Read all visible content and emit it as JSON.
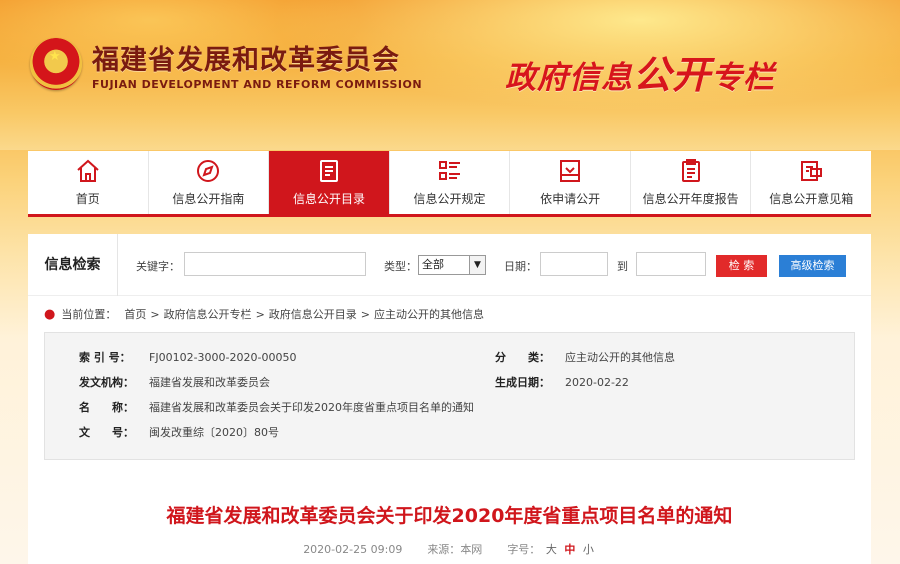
{
  "header": {
    "org_cn": "福建省发展和改革委员会",
    "org_en": "FUJIAN DEVELOPMENT AND REFORM COMMISSION",
    "column_title_a": "政府信息",
    "column_title_b": "公开",
    "column_title_c": "专栏"
  },
  "nav": {
    "items": [
      {
        "label": "首页",
        "icon": "home-icon"
      },
      {
        "label": "信息公开指南",
        "icon": "compass-icon"
      },
      {
        "label": "信息公开目录",
        "icon": "document-list-icon"
      },
      {
        "label": "信息公开规定",
        "icon": "rules-list-icon"
      },
      {
        "label": "依申请公开",
        "icon": "inbox-icon"
      },
      {
        "label": "信息公开年度报告",
        "icon": "clipboard-icon"
      },
      {
        "label": "信息公开意见箱",
        "icon": "feedback-icon"
      }
    ],
    "active_index": 2,
    "active_color": "#d0161c"
  },
  "search": {
    "title": "信息检索",
    "keyword_label": "关键字：",
    "keyword_value": "",
    "type_label": "类型：",
    "type_selected": "全部",
    "date_label": "日期：",
    "date_to_label": "到",
    "search_button": "检 索",
    "advanced_button": "高级检索"
  },
  "breadcrumb": {
    "prefix": "当前位置：",
    "items": [
      "首页",
      "政府信息公开专栏",
      "政府信息公开目录",
      "应主动公开的其他信息"
    ],
    "separator": ">"
  },
  "info": {
    "index_key": "索 引 号：",
    "index_value": "FJ00102-3000-2020-00050",
    "category_key": "分　　类：",
    "category_value": "应主动公开的其他信息",
    "issuer_key": "发文机构：",
    "issuer_value": "福建省发展和改革委员会",
    "date_key": "生成日期：",
    "date_value": "2020-02-22",
    "name_key": "名　　称：",
    "name_value": "福建省发展和改革委员会关于印发2020年度省重点项目名单的通知",
    "docno_key": "文　　号：",
    "docno_value": "闽发改重综〔2020〕80号"
  },
  "document": {
    "title": "福建省发展和改革委员会关于印发2020年度省重点项目名单的通知",
    "datetime": "2020-02-25 09:09",
    "source_label": "来源：",
    "source_value": "本网",
    "font_label": "字号：",
    "font_large": "大",
    "font_medium": "中",
    "font_small": "小"
  }
}
